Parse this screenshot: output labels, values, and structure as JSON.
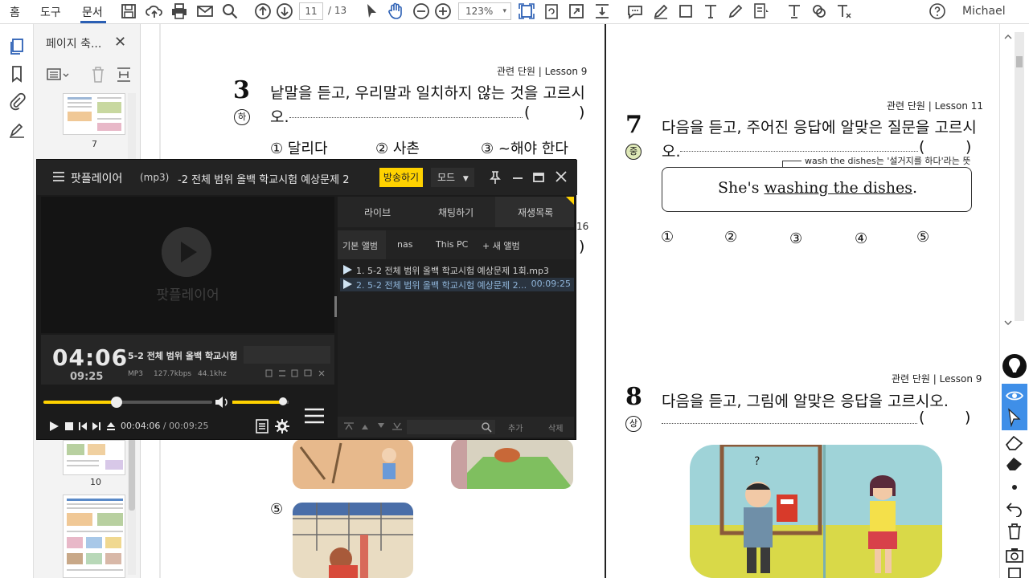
{
  "menu": {
    "home": "홈",
    "tools": "도구",
    "document": "문서"
  },
  "toolbar": {
    "current_page": "11",
    "page_total": "/ 13",
    "zoom": "123%",
    "zoom_caret": "▾",
    "user": "Michael",
    "icons": [
      "save-icon",
      "upload-icon",
      "print-icon",
      "email-icon",
      "search-icon",
      "page-up-icon",
      "page-down-icon",
      "select-icon",
      "hand-icon",
      "zoom-out-icon",
      "zoom-in-icon"
    ]
  },
  "thumbs": {
    "title": "페이지 축...",
    "close": "✕",
    "pages": [
      {
        "num": "7"
      },
      {
        "num": "10"
      }
    ]
  },
  "doc": {
    "q3": {
      "unit": "관련 단원 | Lesson 9",
      "num": "3",
      "level": "하",
      "text_line1": "낱말을 듣고, 우리말과 일치하지 않는 것을 고르시",
      "text_line2": "오.",
      "paren_open": "(",
      "paren_close": ")",
      "choices": [
        "① 달리다",
        "② 사촌",
        "③ ~해야 한다"
      ],
      "fragment_num": "16",
      "fragment_paren": ")"
    },
    "q5_label": "⑤",
    "q7": {
      "unit": "관련 단원 | Lesson 11",
      "num": "7",
      "level": "중",
      "text_line1": "다음을 듣고, 주어진 응답에 알맞은 질문을 고르시",
      "text_line2": "오.",
      "paren_open": "(",
      "paren_close": ")",
      "note": "wash the dishes는 '설거지를 하다'라는 뜻입니다.",
      "answer_prefix": "She's ",
      "answer_underlined": "washing the dishes",
      "answer_suffix": ".",
      "choices": [
        "①",
        "②",
        "③",
        "④",
        "⑤"
      ]
    },
    "q8": {
      "unit": "관련 단원 | Lesson 9",
      "num": "8",
      "level": "상",
      "text": "다음을 듣고, 그림에 알맞은 응답을 고르시오.",
      "paren_open": "(",
      "paren_close": ")"
    }
  },
  "player": {
    "brand": "팟플레이어",
    "format": "(mp3)",
    "title": "-2 전체 범위 올백 학교시험 예상문제 2",
    "broadcast": "방송하기",
    "mode": "모드",
    "mode_caret": "▼",
    "watermark": "팟플레이어",
    "time_current": "04:06",
    "time_total": "09:25",
    "track_title": "5-2 전체 범위 올백 학교시험",
    "meta_type": "MP3",
    "meta_bitrate": "127.7kbps",
    "meta_rate": "44.1khz",
    "progress": 0.435,
    "volume": 0.9,
    "clock_current": "00:04:06",
    "clock_sep": "/",
    "clock_total": "00:09:25",
    "tabs": [
      "라이브",
      "채팅하기",
      "재생목록"
    ],
    "subtabs": [
      "기본 앨범",
      "nas",
      "This PC",
      "+ 새 앨범"
    ],
    "playlist": [
      {
        "name": "1. 5-2 전체 범위 올백 학교시험 예상문제 1회.mp3",
        "duration": ""
      },
      {
        "name": "2. 5-2 전체 범위 올백 학교시험 예상문제 2...",
        "duration": "00:09:25"
      }
    ],
    "add": "추가",
    "delete": "삭제"
  }
}
